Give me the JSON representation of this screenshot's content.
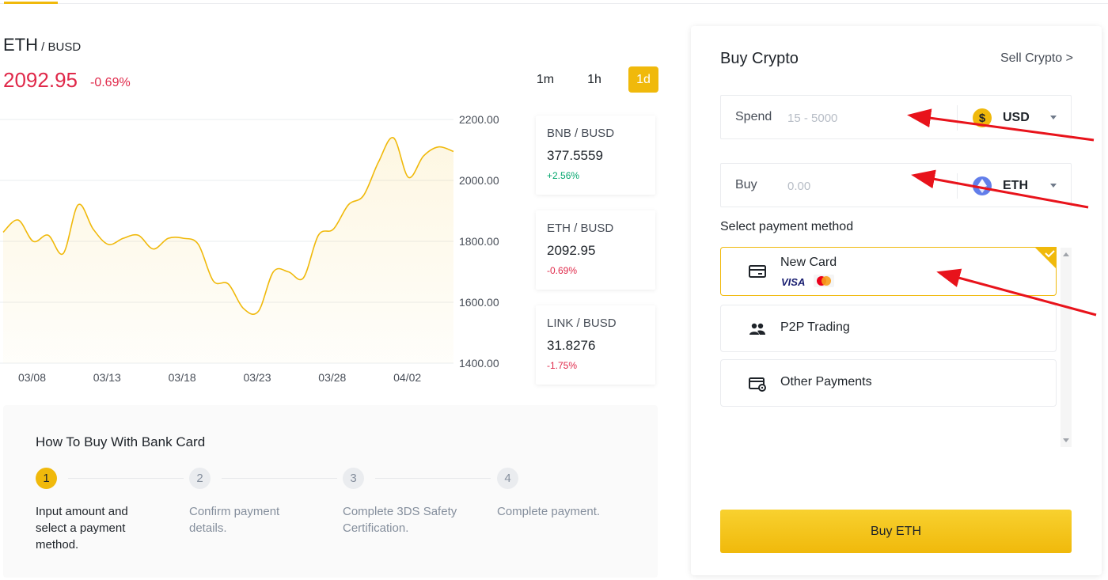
{
  "market": {
    "base": "ETH",
    "sep_quote": " / BUSD",
    "price": "2092.95",
    "change": "-0.69%",
    "timeframes": [
      "1m",
      "1h",
      "1d"
    ],
    "active_timeframe": "1d"
  },
  "chart_data": {
    "type": "area",
    "title": "",
    "x_ticks": [
      "03/08",
      "03/13",
      "03/18",
      "03/23",
      "03/28",
      "04/02"
    ],
    "y_ticks": [
      "2200.00",
      "2000.00",
      "1800.00",
      "1600.00",
      "1400.00"
    ],
    "ylim": [
      1400,
      2200
    ],
    "grid": true,
    "x": [
      "03/07",
      "03/08",
      "03/09",
      "03/10",
      "03/11",
      "03/12",
      "03/13",
      "03/14",
      "03/15",
      "03/16",
      "03/17",
      "03/18",
      "03/19",
      "03/20",
      "03/21",
      "03/22",
      "03/23",
      "03/24",
      "03/25",
      "03/26",
      "03/27",
      "03/28",
      "03/29",
      "03/30",
      "03/31",
      "04/01",
      "04/02",
      "04/03",
      "04/04",
      "04/05",
      "04/06"
    ],
    "values": [
      1830,
      1870,
      1800,
      1820,
      1760,
      1920,
      1840,
      1790,
      1810,
      1820,
      1775,
      1810,
      1810,
      1790,
      1670,
      1660,
      1580,
      1570,
      1700,
      1700,
      1680,
      1820,
      1840,
      1920,
      1950,
      2060,
      2140,
      2010,
      2080,
      2110,
      2095
    ],
    "color": "#f0b90b"
  },
  "tickers": [
    {
      "base": "BNB",
      "quote": " / BUSD",
      "price": "377.5559",
      "change": "+2.56%",
      "color": "#03a66d"
    },
    {
      "base": "ETH",
      "quote": " / BUSD",
      "price": "2092.95",
      "change": "-0.69%",
      "color": "#e0294a"
    },
    {
      "base": "LINK",
      "quote": " / BUSD",
      "price": "31.8276",
      "change": "-1.75%",
      "color": "#e0294a"
    }
  ],
  "howto": {
    "title": "How To Buy With Bank Card",
    "steps": [
      {
        "num": "1",
        "text": "Input amount and select a payment method."
      },
      {
        "num": "2",
        "text": "Confirm payment details."
      },
      {
        "num": "3",
        "text": "Complete 3DS Safety Certification."
      },
      {
        "num": "4",
        "text": "Complete payment."
      }
    ]
  },
  "panel": {
    "title": "Buy Crypto",
    "sell_link": "Sell Crypto >",
    "spend": {
      "label": "Spend",
      "placeholder": "15 - 5000",
      "currency": "USD",
      "icon": "dollar-coin-icon"
    },
    "buy": {
      "label": "Buy",
      "placeholder": "0.00",
      "currency": "ETH",
      "icon": "ethereum-icon"
    },
    "payment_label": "Select payment method",
    "methods": [
      {
        "label": "New Card",
        "icon": "card-icon",
        "selected": true,
        "brands": [
          "VISA",
          "mastercard"
        ]
      },
      {
        "label": "P2P Trading",
        "icon": "people-icon",
        "selected": false
      },
      {
        "label": "Other Payments",
        "icon": "payment-settings-icon",
        "selected": false
      }
    ],
    "buy_button": "Buy ETH"
  },
  "colors": {
    "accent": "#f0b90b",
    "down": "#e0294a",
    "up": "#03a66d",
    "arrow": "#e8131b"
  }
}
